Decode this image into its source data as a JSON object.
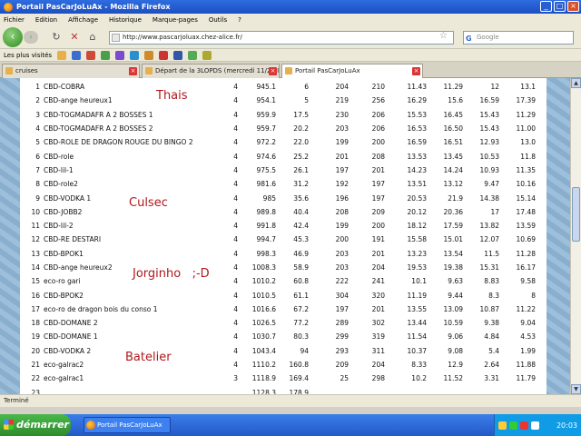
{
  "window": {
    "title": "Portail PasCarJoLuAx - Mozilla Firefox"
  },
  "menu": [
    "Fichier",
    "Edition",
    "Affichage",
    "Historique",
    "Marque-pages",
    "Outils",
    "?"
  ],
  "nav": {
    "url": "http://www.pascarjoluax.chez-alice.fr/",
    "search_placeholder": "Google"
  },
  "bookmarks": [
    "Les plus visités"
  ],
  "tabs": [
    {
      "label": "cruises"
    },
    {
      "label": "Départ de la 3LOPDS (mercredi 11/24/0..."
    },
    {
      "label": "Portail PasCarJoLuAx"
    }
  ],
  "table": {
    "rows": [
      [
        "1",
        "CBD-COBRA",
        "4",
        "945.1",
        "6",
        "204",
        "210",
        "11.43",
        "11.29",
        "12",
        "13.1"
      ],
      [
        "2",
        "CBD-ange heureux1",
        "4",
        "954.1",
        "5",
        "219",
        "256",
        "16.29",
        "15.6",
        "16.59",
        "17.39"
      ],
      [
        "3",
        "CBD-TOGMADAFR A 2 BOSSES 1",
        "4",
        "959.9",
        "17.5",
        "230",
        "206",
        "15.53",
        "16.45",
        "15.43",
        "11.29"
      ],
      [
        "4",
        "CBD-TOGMADAFR A 2 BOSSES 2",
        "4",
        "959.7",
        "20.2",
        "203",
        "206",
        "16.53",
        "16.50",
        "15.43",
        "11.00"
      ],
      [
        "5",
        "CBD-ROLE DE DRAGON ROUGE DU BINGO 2",
        "4",
        "972.2",
        "22.0",
        "199",
        "200",
        "16.59",
        "16.51",
        "12.93",
        "13.0"
      ],
      [
        "6",
        "CBD-role",
        "4",
        "974.6",
        "25.2",
        "201",
        "208",
        "13.53",
        "13.45",
        "10.53",
        "11.8"
      ],
      [
        "7",
        "CBD-lil-1",
        "4",
        "975.5",
        "26.1",
        "197",
        "201",
        "14.23",
        "14.24",
        "10.93",
        "11.35"
      ],
      [
        "8",
        "CBD-role2",
        "4",
        "981.6",
        "31.2",
        "192",
        "197",
        "13.51",
        "13.12",
        "9.47",
        "10.16"
      ],
      [
        "9",
        "CBD-VODKA 1",
        "4",
        "985",
        "35.6",
        "196",
        "197",
        "20.53",
        "21.9",
        "14.38",
        "15.14"
      ],
      [
        "10",
        "CBD-JOBB2",
        "4",
        "989.8",
        "40.4",
        "208",
        "209",
        "20.12",
        "20.36",
        "17",
        "17.48"
      ],
      [
        "11",
        "CBD-lil-2",
        "4",
        "991.8",
        "42.4",
        "199",
        "200",
        "18.12",
        "17.59",
        "13.82",
        "13.59"
      ],
      [
        "12",
        "CBD-RE DESTARI",
        "4",
        "994.7",
        "45.3",
        "200",
        "191",
        "15.58",
        "15.01",
        "12.07",
        "10.69"
      ],
      [
        "13",
        "CBD-BPOK1",
        "4",
        "998.3",
        "46.9",
        "203",
        "201",
        "13.23",
        "13.54",
        "11.5",
        "11.28"
      ],
      [
        "14",
        "CBD-ange heureux2",
        "4",
        "1008.3",
        "58.9",
        "203",
        "204",
        "19.53",
        "19.38",
        "15.31",
        "16.17"
      ],
      [
        "15",
        "eco-ro gari",
        "4",
        "1010.2",
        "60.8",
        "222",
        "241",
        "10.1",
        "9.63",
        "8.83",
        "9.58"
      ],
      [
        "16",
        "CBD-BPOK2",
        "4",
        "1010.5",
        "61.1",
        "304",
        "320",
        "11.19",
        "9.44",
        "8.3",
        "8"
      ],
      [
        "17",
        "eco-ro de dragon bois du conso 1",
        "4",
        "1016.6",
        "67.2",
        "197",
        "201",
        "13.55",
        "13.09",
        "10.87",
        "11.22"
      ],
      [
        "18",
        "CBD-DOMANE 2",
        "4",
        "1026.5",
        "77.2",
        "289",
        "302",
        "13.44",
        "10.59",
        "9.38",
        "9.04"
      ],
      [
        "19",
        "CBD-DOMANE 1",
        "4",
        "1030.7",
        "80.3",
        "299",
        "319",
        "11.54",
        "9.06",
        "4.84",
        "4.53"
      ],
      [
        "20",
        "CBD-VODKA 2",
        "4",
        "1043.4",
        "94",
        "293",
        "311",
        "10.37",
        "9.08",
        "5.4",
        "1.99"
      ],
      [
        "21",
        "eco-galrac2",
        "4",
        "1110.2",
        "160.8",
        "209",
        "204",
        "8.33",
        "12.9",
        "2.64",
        "11.88"
      ],
      [
        "22",
        "eco-galrac1",
        "3",
        "1118.9",
        "169.4",
        "25",
        "298",
        "10.2",
        "11.52",
        "3.31",
        "11.79"
      ],
      [
        "23",
        "",
        "",
        "1128.3",
        "178.9",
        "",
        "",
        "",
        "",
        "",
        ""
      ]
    ]
  },
  "annotations": [
    {
      "text": "Thais"
    },
    {
      "text": "Culsec"
    },
    {
      "text": "Jorginho   ;-D"
    },
    {
      "text": "Batelier"
    }
  ],
  "status": {
    "text": "Terminé"
  },
  "taskbar": {
    "start_label": "démarrer",
    "task_label": "Portail PasCarJoLuAx",
    "clock": "20:03"
  }
}
